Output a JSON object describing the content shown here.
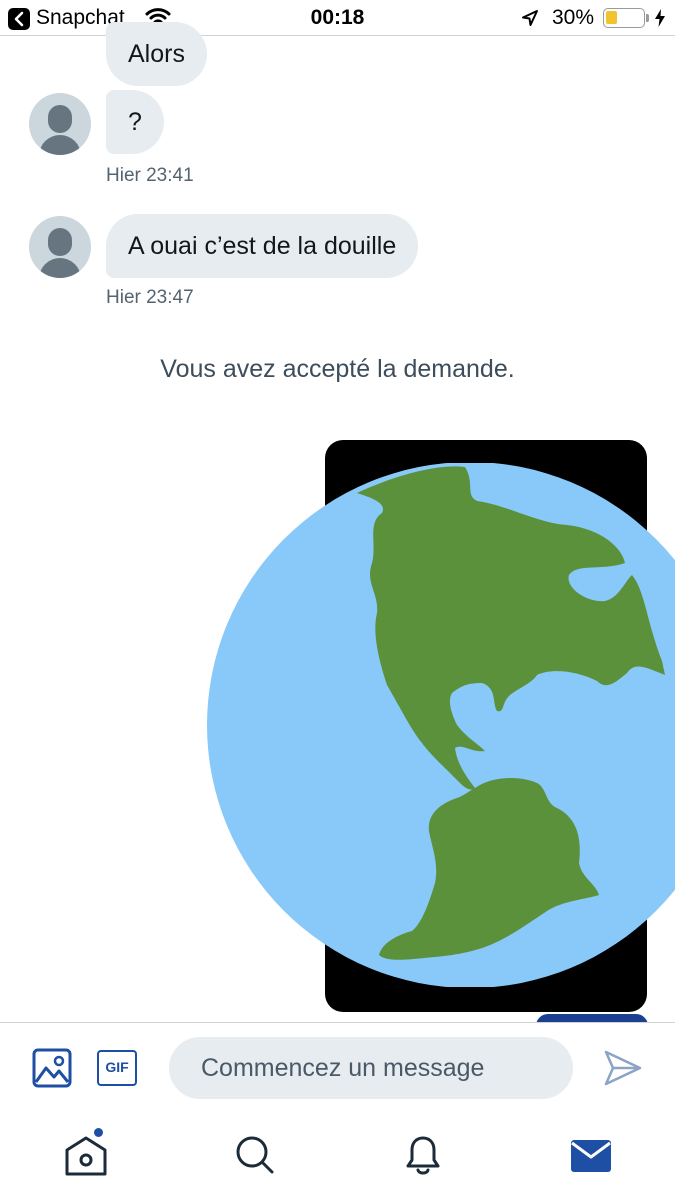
{
  "status_bar": {
    "app_name": "Snapchat",
    "time": "00:18",
    "battery_percent": "30%",
    "battery_level": 0.3
  },
  "messages": [
    {
      "text": "Alors"
    },
    {
      "text": "?"
    },
    {
      "text": "A ouai c’est de la douille"
    }
  ],
  "timestamps": [
    "Hier 23:41",
    "Hier 23:47"
  ],
  "system_message": "Vous avez accepté la demande.",
  "media": {
    "icon": "earth-americas-emoji"
  },
  "composer": {
    "placeholder": "Commencez un message",
    "gif_label": "GIF"
  },
  "tabbar": {
    "items": [
      "home-icon",
      "search-icon",
      "notifications-icon",
      "messages-icon"
    ],
    "active": "messages",
    "accent": "#1d4fa5"
  },
  "colors": {
    "bubble": "#e6ecf0",
    "ocean": "#88c9f9",
    "land": "#5c913b"
  }
}
